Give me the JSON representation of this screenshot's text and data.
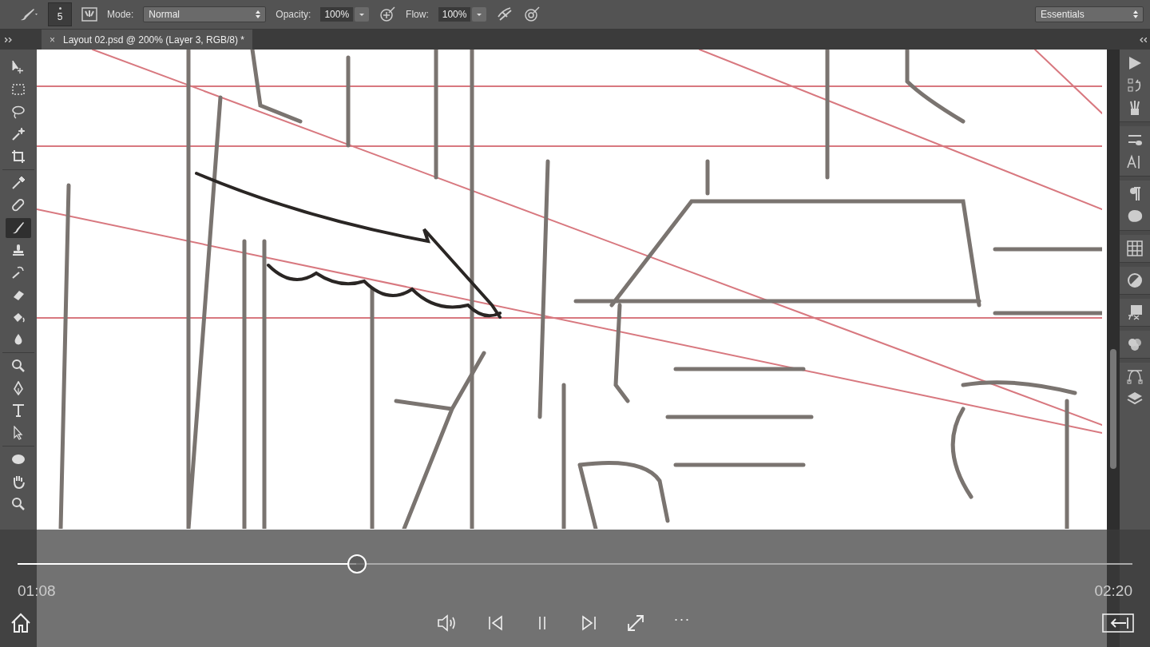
{
  "options_bar": {
    "brush_size": "5",
    "mode_label": "Mode:",
    "mode": "Normal",
    "opacity_label": "Opacity:",
    "opacity": "100%",
    "flow_label": "Flow:",
    "flow": "100%",
    "workspace": "Essentials"
  },
  "document_tab": {
    "close": "×",
    "title": "Layout 02.psd @ 200% (Layer 3, RGB/8) *"
  },
  "tools": [
    {
      "selected": false
    },
    {
      "selected": false
    },
    {
      "selected": false
    },
    {
      "selected": false
    },
    {
      "selected": false
    },
    {
      "selected": false
    },
    {
      "selected": false
    },
    {
      "selected": true
    },
    {
      "selected": false
    },
    {
      "selected": false
    },
    {
      "selected": false
    },
    {
      "selected": false
    },
    {
      "selected": false
    },
    {
      "selected": false
    },
    {
      "selected": false
    },
    {
      "selected": false
    },
    {
      "selected": false
    },
    {
      "selected": false
    },
    {
      "selected": false
    },
    {
      "selected": false
    }
  ],
  "player": {
    "level": 0.304,
    "elapsed": "01:08",
    "duration": "02:20",
    "more": "···"
  }
}
